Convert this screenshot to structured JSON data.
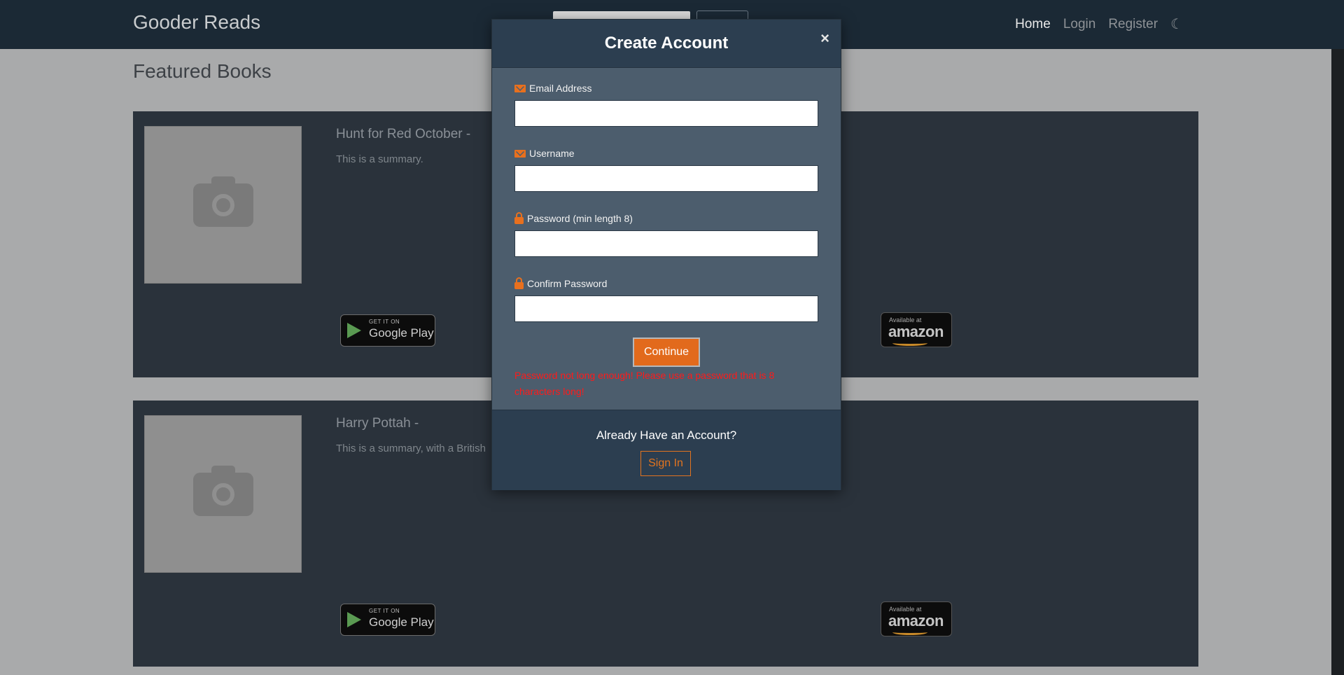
{
  "navbar": {
    "brand": "Gooder Reads",
    "links": [
      "Home",
      "Login",
      "Register"
    ],
    "theme_icon": "moon-icon"
  },
  "page": {
    "section_title": "Featured Books",
    "books": [
      {
        "title": "Hunt for Red October -",
        "summary": "This is a summary.",
        "cover_icon": "camera-icon"
      },
      {
        "title": "Harry Pottah -",
        "summary": "This is a summary, with a British",
        "cover_icon": "camera-icon"
      }
    ],
    "badges": {
      "google_small": "GET IT ON",
      "google_big": "Google Play",
      "amazon_small": "Available at",
      "amazon_big": "amazon"
    }
  },
  "modal": {
    "title": "Create Account",
    "close_label": "×",
    "fields": [
      {
        "label": "Email Address",
        "icon": "envelope-icon",
        "value": ""
      },
      {
        "label": "Username",
        "icon": "envelope-icon",
        "value": ""
      },
      {
        "label": "Password (min length 8)",
        "icon": "lock-icon",
        "value": ""
      },
      {
        "label": "Confirm Password",
        "icon": "lock-icon",
        "value": ""
      }
    ],
    "continue_label": "Continue",
    "error": "Password not long enough! Please use a password that is 8 characters long!",
    "footer_text": "Already Have an Account?",
    "signin_label": "Sign In"
  },
  "colors": {
    "accent": "#e26a1c",
    "error": "#ff1a1a",
    "modal_header": "#2c3e50",
    "modal_body": "#4c5d6d"
  }
}
